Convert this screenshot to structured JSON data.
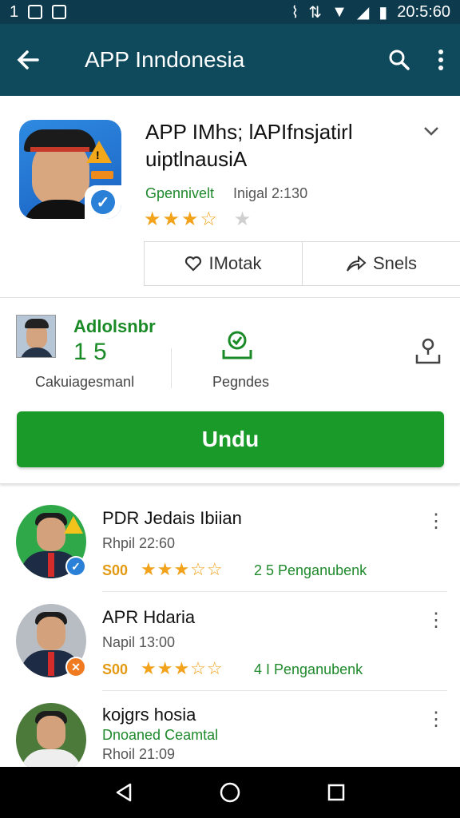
{
  "status_bar": {
    "left_text": "1",
    "time": "20:5:60"
  },
  "app_bar": {
    "title": "APP Inndonesia"
  },
  "app": {
    "title": "APP IMhs; lAPIfnsjatirl uiptlnausiA",
    "developer": "Gpennivelt",
    "version": "Inigal 2:130",
    "rating_stars": "★★★☆",
    "rating_empty": "★"
  },
  "actions": {
    "wishlist": "IMotak",
    "share": "Snels"
  },
  "stats": {
    "name": "Adlolsnbr",
    "number": "1 5",
    "label": "Cakuiagesmanl",
    "downloads_label": "Pegndes"
  },
  "install_button": "Undu",
  "list": [
    {
      "name": "PDR Jedais Ibiian",
      "sub": "Rhpil 22:60",
      "score": "S00",
      "stars": "★★★☆☆",
      "count": "2 5  Penganubenk",
      "avatar_bg": "#2fa84a",
      "badge_bg": "#2a7fd6",
      "badge": "✓"
    },
    {
      "name": "APR Hdaria",
      "sub": "Napil 13:00",
      "score": "S00",
      "stars": "★★★☆☆",
      "count": "4 I  Penganubenk",
      "avatar_bg": "#b8bdc4",
      "badge_bg": "#ef7a1f",
      "badge": "✕"
    },
    {
      "name": "kojgrs hosia",
      "sub": "Dnoaned  Ceamtal",
      "sub2": "Rhoil 21:09",
      "avatar_bg": "#4c7a3a"
    }
  ],
  "colors": {
    "header": "#0f4a5c",
    "accent_green": "#1a9a29",
    "star": "#f2a21b"
  }
}
